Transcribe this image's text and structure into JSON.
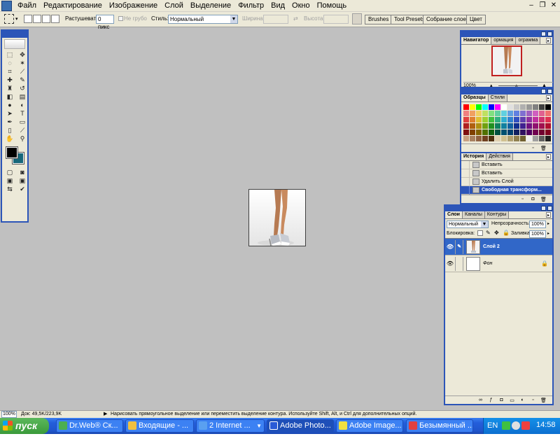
{
  "menubar": {
    "items": [
      "Файл",
      "Редактирование",
      "Изображение",
      "Слой",
      "Выделение",
      "Фильтр",
      "Вид",
      "Окно",
      "Помощь"
    ]
  },
  "options": {
    "feather_label": "Растушевать:",
    "feather_value": "0 пикс",
    "antialias_label": "Не грубо",
    "style_label": "Стиль:",
    "style_value": "Нормальный",
    "width_label": "Ширина:",
    "height_label": "Высота:",
    "well_tabs": [
      "Brushes",
      "Tool Presets",
      "Собрание слоев",
      "Цвет"
    ]
  },
  "colors": {
    "foreground": "#000000",
    "background": "#16677a",
    "accent": "#2c55b8"
  },
  "navigator": {
    "tabs": [
      "Навигатор",
      "ормация",
      "ограмма"
    ],
    "zoom": "100%"
  },
  "swatches_panel": {
    "tabs": [
      "Образцы",
      "Стили"
    ]
  },
  "history": {
    "tabs": [
      "История",
      "Действия"
    ],
    "items": [
      "Вставить",
      "Вставить",
      "Удалить Слой",
      "Свободная трансформ..."
    ]
  },
  "layers": {
    "tabs": [
      "Слои",
      "Каналы",
      "Контуры"
    ],
    "blend_mode": "Нормальный",
    "opacity_label": "Непрозрачность:",
    "opacity_value": "100%",
    "lock_label": "Блокировка:",
    "fill_label": "Заливка:",
    "fill_value": "100%",
    "items": [
      {
        "name": "Слой 2"
      },
      {
        "name": "Фон"
      }
    ]
  },
  "status": {
    "zoom": "100%",
    "doc": "Док: 49,5K/223,9K",
    "hint": "Нарисовать прямоугольное выделение или переместить выделение контура. Используйте Shift, Alt, и Ctrl для дополнительных опций."
  },
  "taskbar": {
    "start_label": "пуск",
    "tasks": [
      "Dr.Web® Ск...",
      "Входящие - ...",
      "2 Internet ...",
      "Adobe Photo...",
      "Adobe Image...",
      "Безымянный ..."
    ],
    "lang": "EN",
    "clock": "14:58"
  }
}
